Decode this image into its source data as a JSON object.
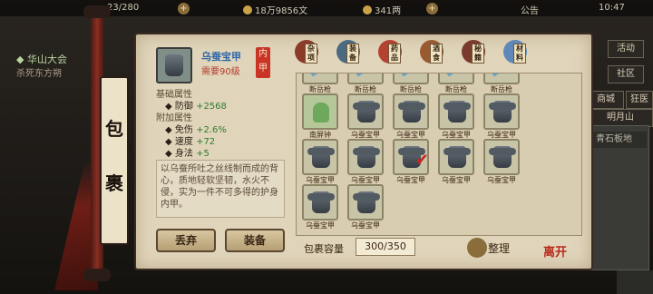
{
  "topbar": {
    "level_text": "23/280",
    "silver": "18万9856文",
    "gold": "341两",
    "notice": "公告",
    "time": "10:47"
  },
  "quest": {
    "title": "华山大会",
    "sub": "杀死东方朔"
  },
  "right_menu": [
    "活动",
    "社区",
    "商城",
    "狂医",
    "明月山"
  ],
  "right_panel_item": "青石板地",
  "bag_title": [
    "包",
    "裹"
  ],
  "item": {
    "name": "乌蚕宝甲",
    "requirement": "需要90级",
    "slot_seal": "内甲",
    "base_header": "基础属性",
    "defense_label": "防御",
    "defense_value": "+2568",
    "extra_header": "附加属性",
    "attrs": [
      {
        "name": "免伤",
        "value": "+2.6%"
      },
      {
        "name": "速度",
        "value": "+72"
      },
      {
        "name": "身法",
        "value": "+5"
      }
    ],
    "description": "以乌蚕所吐之丝线制而成的背心，质地轻软坚韧，水火不侵，实为一件不可多得的护身内甲。"
  },
  "buttons": {
    "discard": "丢弃",
    "equip": "装备"
  },
  "tabs": [
    {
      "label": "杂项",
      "icon": "pot-icon",
      "color": "#8c3b2a"
    },
    {
      "label": "装备",
      "icon": "sword-icon",
      "color": "#4d6b80"
    },
    {
      "label": "药品",
      "icon": "fruit-icon",
      "color": "#b54130"
    },
    {
      "label": "酒食",
      "icon": "food-icon",
      "color": "#9a5a30"
    },
    {
      "label": "秘籍",
      "icon": "book-icon",
      "color": "#7a3b2e"
    },
    {
      "label": "材料",
      "icon": "crystal-icon",
      "color": "#5f88b8"
    }
  ],
  "grid_items": [
    {
      "label": "断岳枪",
      "kind": "sword"
    },
    {
      "label": "断岳枪",
      "kind": "sword"
    },
    {
      "label": "断岳枪",
      "kind": "sword"
    },
    {
      "label": "断岳枪",
      "kind": "sword"
    },
    {
      "label": "断岳枪",
      "kind": "sword"
    },
    {
      "label": "南屏钟",
      "kind": "bell"
    },
    {
      "label": "乌蚕宝甲",
      "kind": "armor"
    },
    {
      "label": "乌蚕宝甲",
      "kind": "armor"
    },
    {
      "label": "乌蚕宝甲",
      "kind": "armor"
    },
    {
      "label": "乌蚕宝甲",
      "kind": "armor"
    },
    {
      "label": "乌蚕宝甲",
      "kind": "armor"
    },
    {
      "label": "乌蚕宝甲",
      "kind": "armor"
    },
    {
      "label": "乌蚕宝甲",
      "kind": "armor",
      "checked": true
    },
    {
      "label": "乌蚕宝甲",
      "kind": "armor"
    },
    {
      "label": "乌蚕宝甲",
      "kind": "armor"
    },
    {
      "label": "乌蚕宝甲",
      "kind": "armor"
    },
    {
      "label": "乌蚕宝甲",
      "kind": "armor"
    }
  ],
  "capacity": {
    "label": "包裹容量",
    "value": "300/350"
  },
  "sort_label": "整理",
  "stamp_text": "离开"
}
